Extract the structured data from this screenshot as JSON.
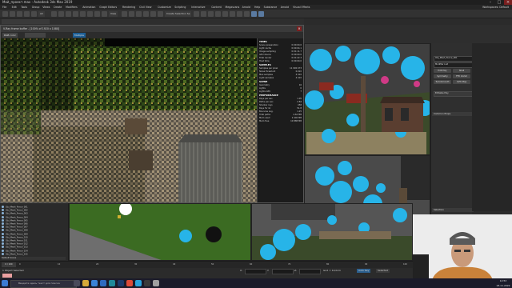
{
  "window": {
    "title": "Мой_проект.max - Autodesk 3ds Max 2019"
  },
  "menu": {
    "items": [
      "File",
      "Edit",
      "Tools",
      "Group",
      "Views",
      "Create",
      "Modifiers",
      "Animation",
      "Graph Editors",
      "Rendering",
      "Civil View",
      "Customize",
      "Scripting",
      "Interactive",
      "Content",
      "Megascans",
      "Arnold",
      "Help",
      "Substance",
      "Arnold",
      "Visual Effects"
    ],
    "workspace": "Workspaces: Default"
  },
  "toolbar": {
    "filter": "All",
    "view": "View",
    "selection_set": "Create Selection Se"
  },
  "frame_buffer": {
    "title": "V-Ray frame buffer - [100% of 1920 x 1080]",
    "channel": "RGB color",
    "display": "Multiple"
  },
  "stats": {
    "sections": [
      {
        "heading": "TIMES",
        "rows": [
          [
            "Scene preparation",
            "0:00:00.0"
          ],
          [
            "Light cache",
            "0:00:04.1"
          ],
          [
            "Image sampling",
            "0:01:11.7"
          ],
          [
            "GPU device",
            "0:00:00.0"
          ],
          [
            "Total render",
            "0:01:22.3"
          ],
          [
            "Host time",
            "0:00:00.0"
          ]
        ]
      },
      {
        "heading": "SAMPLES",
        "rows": [
          [
            "Samples per pixel",
            "11 900 073"
          ],
          [
            "Noise threshold",
            "0.010"
          ],
          [
            "Max samples",
            "4 410"
          ],
          [
            "Light samples",
            "4 410"
          ]
        ]
      },
      {
        "heading": "SCENE",
        "rows": [
          [
            "Geometry",
            "16"
          ],
          [
            "Lights",
            "0"
          ],
          [
            "Lights GPU",
            "7"
          ]
        ]
      },
      {
        "heading": "PERFORMANCE",
        "rows": [
          [
            "Rays per sec.",
            "1.05"
          ],
          [
            "Paths per sec.",
            "2.84"
          ],
          [
            "Shadow rays",
            "458"
          ],
          [
            "Rays for GI",
            "51.8"
          ],
          [
            "Bounces avg.",
            "1.25"
          ],
          [
            "Total paths",
            "4.62 MB"
          ],
          [
            "Mem used",
            "2 440 MB"
          ],
          [
            "Mem free",
            "10 888 MB"
          ]
        ]
      }
    ]
  },
  "scene_list": {
    "items": [
      "Obj_Mesh_Fence_001",
      "Obj_Mesh_Fence_002",
      "Obj_Mesh_Fence_003",
      "Obj_Mesh_Fence_004",
      "Obj_Mesh_Fence_005",
      "Obj_Mesh_Fence_006",
      "Obj_Mesh_Fence_007",
      "Obj_Mesh_Fence_008",
      "Obj_Mesh_Fence_009",
      "Obj_Mesh_Fence_010",
      "Obj_Mesh_Fence_011",
      "Obj_Mesh_Fence_012",
      "Obj_Mesh_Fence_013",
      "Obj_Mesh_Fence_014",
      "Obj_Mesh_Fence_015"
    ],
    "footer": "Default Scene"
  },
  "command_panel": {
    "object_name": "Obj_Mesh_Fence_001",
    "modifier_list": "Modifier List",
    "buttons": [
      "Edit Poly",
      "Shell",
      "Symmetry",
      "FFD 2x2x2",
      "TurboSmooth",
      "UVW Map"
    ],
    "stack_item": "Editable Poly",
    "section_1": "Common Props",
    "section_2": "Selection"
  },
  "timeline": {
    "frame": "0 / 100",
    "ticks": [
      "0",
      "10",
      "20",
      "30",
      "40",
      "50",
      "60",
      "70",
      "80",
      "90",
      "100"
    ]
  },
  "status": {
    "selected": "1 Object Selected",
    "x": "X:",
    "y": "Y:",
    "z": "Z:",
    "grid": "Grid = 10,0cm",
    "autokey": "Auto Key",
    "selected_mode": "Selected"
  },
  "taskbar": {
    "search_placeholder": "Введите здесь текст для поиска",
    "time": "12:53",
    "date": "18.11.2022"
  },
  "colors": {
    "accent": "#1e90d0",
    "tree_cyan": "#27b4e8",
    "grass": "#3b6b22",
    "cabin_red": "#8a2a20"
  }
}
